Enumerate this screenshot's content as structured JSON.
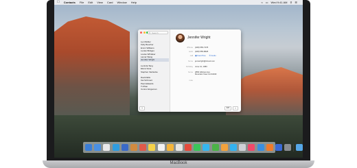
{
  "menubar": {
    "apple": "",
    "app": "Contacts",
    "items": [
      "File",
      "Edit",
      "View",
      "Card",
      "Window",
      "Help"
    ],
    "status": [
      "Wed 9:41 AM"
    ]
  },
  "window": {
    "search_placeholder": "Search",
    "sidebar_groups": [
      {
        "letter": "",
        "contacts": [
          "Lyn Mahler",
          "Kelly Boucher",
          "Emmi Williams",
          "Lucian Bridges",
          "Louise Whitaker",
          "Lamar Wang",
          "Jennifer Wright"
        ]
      },
      {
        "letter": "",
        "contacts": [
          "Lucinda Tang",
          "Elena Sosa",
          "Stephen Vanliecke"
        ]
      },
      {
        "letter": "",
        "contacts": [
          "David Ellis",
          "Kai Schimert",
          "Paul Edwards",
          "Ti Zhao",
          "Connor Engeman"
        ]
      }
    ],
    "selected_contact": "Jennifer Wright",
    "card": {
      "name": "Jennifer Wright",
      "fields": [
        {
          "label": "iPhone",
          "value": "(408) 555-7378"
        },
        {
          "label": "work",
          "value": "(408) 555-8828"
        },
        {
          "label": "call",
          "value": ""
        },
        {
          "label": "home",
          "value": "jennwright@icloud.com"
        },
        {
          "label": "birthday",
          "value": "June 13, 1983"
        }
      ],
      "facetime_buttons": [
        "FaceTime",
        "Audio"
      ],
      "address_label": "home",
      "address_lines": [
        "2860 Hillview Ave",
        "Mountain View CA 94040"
      ],
      "note_label": "note",
      "edit_label": "Edit"
    },
    "add_label": "+"
  },
  "dock": {
    "icon_colors": [
      "#3b7ed6",
      "#4a90e2",
      "#e8e8ea",
      "#2f9de0",
      "#3a6ac8",
      "#d28a3f",
      "#e05a4a",
      "#f5d24a",
      "#f2f2f2",
      "#f5b53a",
      "#e8e6e2",
      "#e54b3c",
      "#3bc65a",
      "#35b6f0",
      "#4bb347",
      "#f2a23c",
      "#33b3f0",
      "#cfd1d6",
      "#f04a6a",
      "#3a8fe0",
      "#f07b2b",
      "#3b6ad6",
      "#8a8d92"
    ],
    "trailing_colors": [
      "#56a7e8",
      "#c3c6cb"
    ]
  },
  "macbook_label": "MacBook"
}
